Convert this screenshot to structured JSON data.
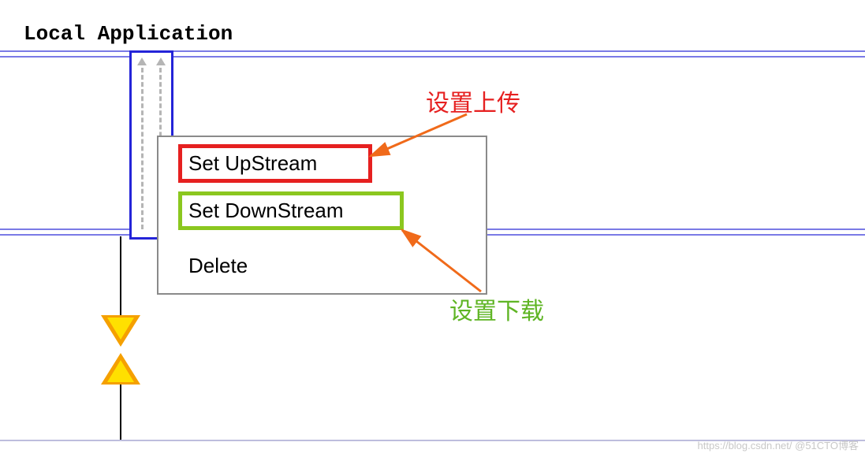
{
  "header": {
    "title": "Local Application"
  },
  "menu": {
    "upstream": "Set UpStream",
    "downstream": "Set DownStream",
    "delete": "Delete"
  },
  "annotations": {
    "upload": "设置上传",
    "download": "设置下载"
  },
  "watermark": "https://blog.csdn.net/  @51CTO博客"
}
